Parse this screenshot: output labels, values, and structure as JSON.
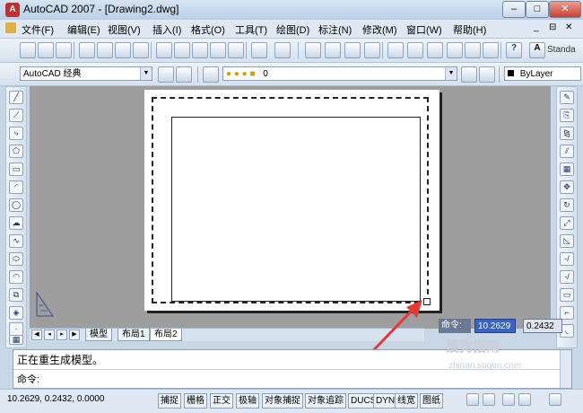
{
  "window": {
    "title": "AutoCAD 2007 - [Drawing2.dwg]",
    "app_icon": "A",
    "controls": [
      "–",
      "□",
      "✕"
    ]
  },
  "menu": [
    "文件(F)",
    "编辑(E)",
    "视图(V)",
    "插入(I)",
    "格式(O)",
    "工具(T)",
    "绘图(D)",
    "标注(N)",
    "修改(M)",
    "窗口(W)",
    "帮助(H)"
  ],
  "doc_controls": [
    "_",
    "⊟",
    "✕"
  ],
  "toolbar1": {
    "style_label": "Standa"
  },
  "toolbar2": {
    "workspace": "AutoCAD 经典",
    "layer": "0",
    "color": "ByLayer"
  },
  "layout_tabs": [
    "模型",
    "布局1",
    "布局2"
  ],
  "active_tab": "布局2",
  "dynamic_input": {
    "label": "命令:",
    "value_x": "10.2629",
    "value_y": "0.2432"
  },
  "command_window": {
    "history": "正在重生成模型。",
    "prompt": "命令:"
  },
  "status_bar": {
    "coordinates": "10.2629, 0.2432, 0.0000",
    "toggles": [
      "捕捉",
      "栅格",
      "正交",
      "极轴",
      "对象捕捉",
      "对象追踪",
      "DUCS",
      "DYN",
      "线宽",
      "图纸"
    ]
  },
  "watermark": {
    "line1": "搜狗指南",
    "line2": "zhinan.sogou.com"
  },
  "colors": {
    "annotation_arrow": "#e53935",
    "dyn_value_bg": "#3a63c6"
  }
}
